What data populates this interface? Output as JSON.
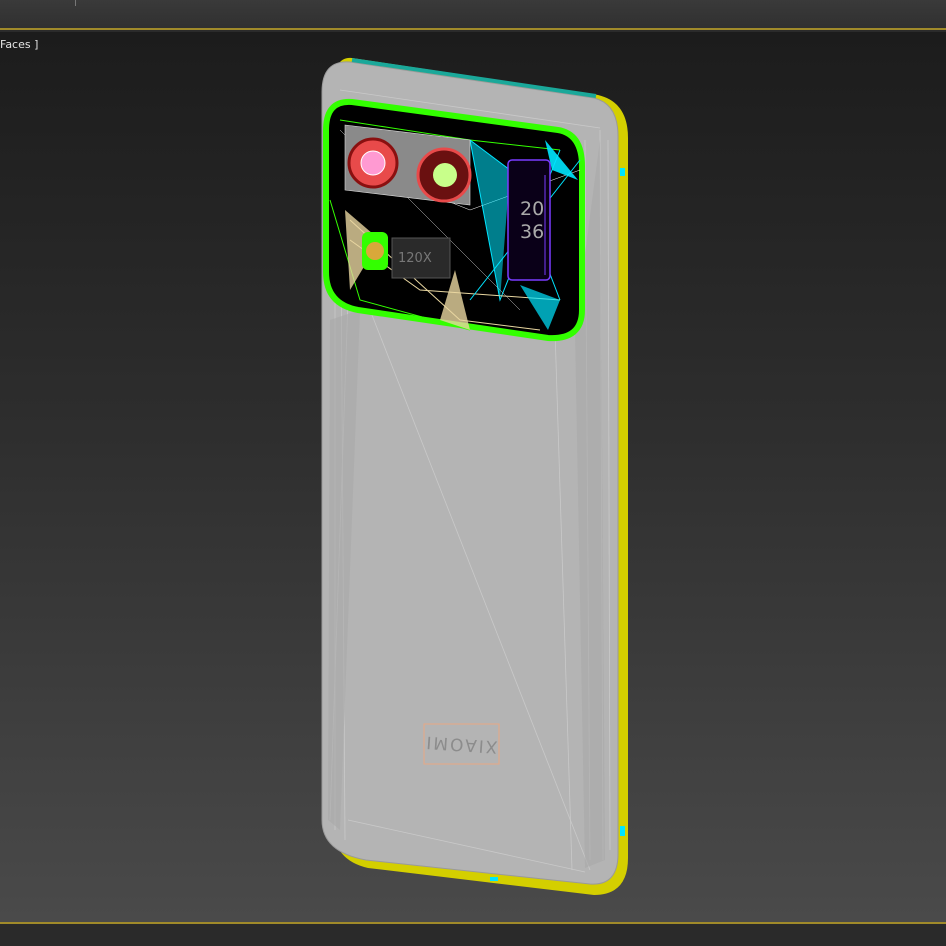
{
  "viewport": {
    "label": "Faces ]"
  },
  "phone": {
    "brand_text": "XIAOMI",
    "clock_hours": "20",
    "clock_minutes": "36",
    "zoom_badge": "120X",
    "colors": {
      "body": "#b4b4b4",
      "edge_highlight": "#d4cf00",
      "camera_outline": "#33ff00",
      "wire_cyan": "#00e5ff",
      "wire_tan": "#e8d6a0",
      "lens_red": "#e84a4a",
      "lens_pink": "#ff9ad2",
      "lens_green": "#c8ff8a"
    }
  }
}
